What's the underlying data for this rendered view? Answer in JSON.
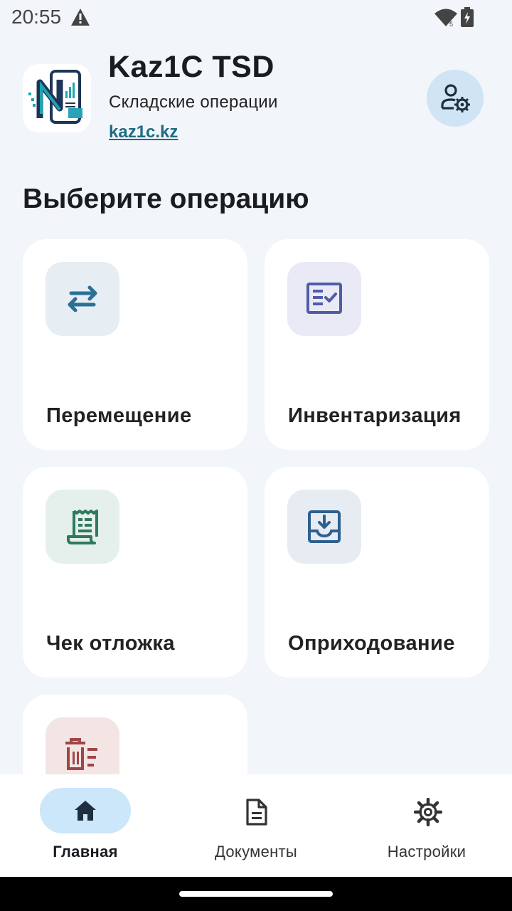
{
  "status": {
    "time": "20:55",
    "wifi_badge": "5"
  },
  "header": {
    "title": "Kaz1C TSD",
    "subtitle": "Складские операции",
    "link": "kaz1c.kz",
    "profile_icon": "user-settings-icon"
  },
  "main": {
    "title": "Выберите операцию",
    "cards": [
      {
        "label": "Перемещение",
        "icon": "transfer-arrows-icon",
        "icon_color": "#2b6f97",
        "icon_bg": "#e6edf3"
      },
      {
        "label": "Инвентаризация",
        "icon": "checklist-icon",
        "icon_color": "#4f5ca8",
        "icon_bg": "#e9eaf5"
      },
      {
        "label": "Чек отложка",
        "icon": "receipt-icon",
        "icon_color": "#2f7a5d",
        "icon_bg": "#e5efeb"
      },
      {
        "label": "Оприходование",
        "icon": "inbox-download-icon",
        "icon_color": "#2f5f8f",
        "icon_bg": "#e6ecf2"
      },
      {
        "label": "",
        "icon": "delete-list-icon",
        "icon_color": "#a04646",
        "icon_bg": "#f4e5e5"
      }
    ]
  },
  "nav": {
    "items": [
      {
        "label": "Главная",
        "icon": "home-icon",
        "active": true
      },
      {
        "label": "Документы",
        "icon": "document-icon",
        "active": false
      },
      {
        "label": "Настройки",
        "icon": "gear-icon",
        "active": false
      }
    ],
    "active_color": "#cce6fa"
  }
}
